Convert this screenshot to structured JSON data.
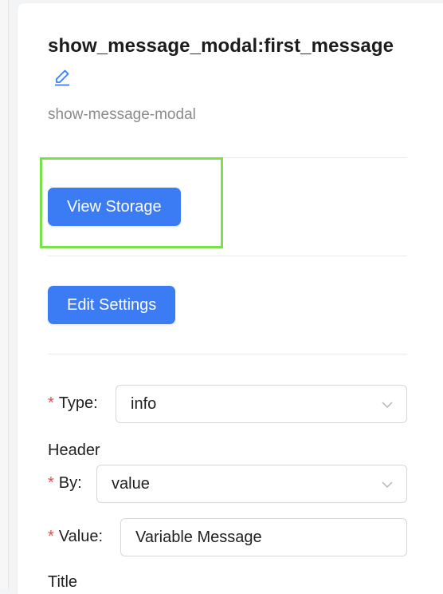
{
  "header": {
    "title": "show_message_modal:first_message",
    "subtitle": "show-message-modal"
  },
  "actions": {
    "view_storage_label": "View Storage",
    "edit_settings_label": "Edit Settings"
  },
  "form": {
    "type": {
      "label": "Type",
      "value": "info"
    },
    "header_section": "Header",
    "by": {
      "label": "By",
      "value": "value"
    },
    "value": {
      "label": "Value",
      "value": "Variable Message"
    },
    "title_section": "Title"
  },
  "colors": {
    "primary": "#3b7cf4",
    "required": "#e34d4d",
    "highlight": "#7be14a",
    "muted_text": "#8b8b8b"
  }
}
